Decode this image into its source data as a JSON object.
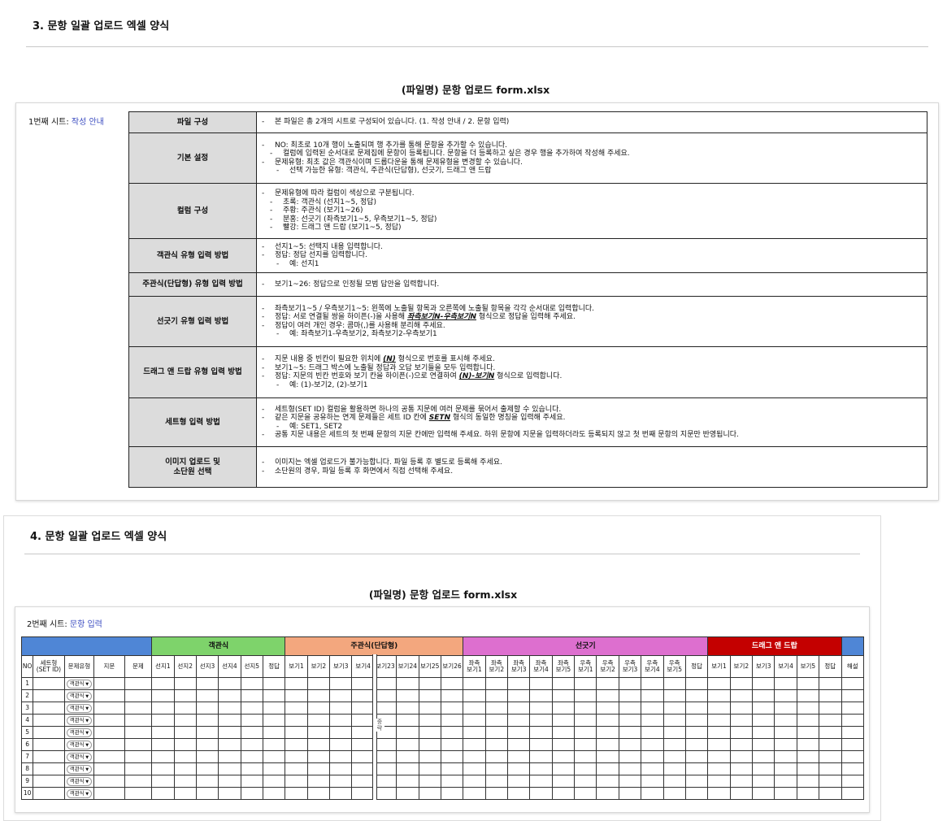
{
  "section3": {
    "title": "3. 문항 일괄 업로드 엑셀 양식",
    "file_title": "(파일명) 문항 업로드 form.xlsx",
    "sheet_label_prefix": "1번째 시트: ",
    "sheet_label_name": "작성 안내",
    "rows": [
      {
        "label": "파일 구성",
        "lines": [
          {
            "lv": 1,
            "t": "본 파일은 총 2개의 시트로 구성되어 있습니다. (1. 작성 안내 / 2. 문항 입력)"
          }
        ]
      },
      {
        "label": "기본 설정",
        "lines": [
          {
            "lv": 1,
            "t": "NO: 최초로 10개 행이 노출되며 행 추가를 통해 문항을 추가할 수 있습니다."
          },
          {
            "lv": 2,
            "t": "컬럼에 입력된 순서대로 문제집에 문항이 등록됩니다. 문항을 더 등록하고 싶은 경우 행을 추가하여 작성해 주세요."
          },
          {
            "lv": 1,
            "t": "문제유형: 최초 값은 객관식이며 드롭다운을 통해 문제유형을 변경할 수 있습니다."
          },
          {
            "lv": 3,
            "t": "선택 가능한 유형: 객관식, 주관식(단답형), 선긋기, 드래그 앤 드랍"
          }
        ]
      },
      {
        "label": "컬럼 구성",
        "lines": [
          {
            "lv": 1,
            "t": "문제유형에 따라 컬럼이 색상으로 구분됩니다."
          },
          {
            "lv": 2,
            "t": "초록: 객관식 (선지1~5, 정답)"
          },
          {
            "lv": 2,
            "t": "주황: 주관식 (보기1~26)"
          },
          {
            "lv": 2,
            "t": "분홍: 선긋기 (좌측보기1~5, 우측보기1~5, 정답)"
          },
          {
            "lv": 2,
            "t": "빨강: 드래그 앤 드랍 (보기1~5, 정답)"
          }
        ]
      },
      {
        "label": "객관식 유형 입력 방법",
        "lines": [
          {
            "lv": 1,
            "t": "선지1~5: 선택지 내용 입력합니다."
          },
          {
            "lv": 1,
            "t": "정답: 정답 선지를 입력합니다."
          },
          {
            "lv": 3,
            "t": "예: 선지1"
          }
        ]
      },
      {
        "label": "주관식(단답형) 유형 입력 방법",
        "lines": [
          {
            "lv": 1,
            "t": "보기1~26: 정답으로 인정될 모범 답안을 입력합니다."
          }
        ]
      },
      {
        "label": "선긋기 유형 입력 방법",
        "lines": [
          {
            "lv": 1,
            "t": "좌측보기1~5 / 우측보기1~5: 왼쪽에 노출될 항목과 오른쪽에 노출될 항목을 각각 순서대로 입력합니다."
          },
          {
            "lv": 1,
            "pre": "정답: 서로 연결될 쌍을 하이픈(-)을 사용해 ",
            "em": "좌측보기N-우측보기N",
            "post": " 형식으로 정답을 입력해 주세요."
          },
          {
            "lv": 1,
            "t": "정답이 여러 개인 경우: 콤마(,)를 사용해 분리해 주세요."
          },
          {
            "lv": 3,
            "t": "예: 좌측보기1-우측보기2, 좌측보기2-우측보기1"
          }
        ]
      },
      {
        "label": "드래그 앤 드랍 유형 입력 방법",
        "lines": [
          {
            "lv": 1,
            "pre": "지문 내용 중 빈칸이 필요한 위치에 ",
            "em": "(N)",
            "post": " 형식으로 번호를 표시해 주세요."
          },
          {
            "lv": 1,
            "t": "보기1~5: 드래그 박스에 노출될 정답과 오답 보기들을 모두 입력합니다."
          },
          {
            "lv": 1,
            "pre": "정답: 지문의 빈칸 번호와 보기 칸을 하이픈(-)으로 연결하여 ",
            "em": "(N)-보기N",
            "post": " 형식으로 입력합니다."
          },
          {
            "lv": 3,
            "t": "예: (1)-보기2, (2)-보기1"
          }
        ]
      },
      {
        "label": "세트형 입력 방법",
        "lines": [
          {
            "lv": 1,
            "t": "세트형(SET ID) 컬럼을 활용하면 하나의 공통 지문에 여러 문제를 묶어서 출제할 수 있습니다."
          },
          {
            "lv": 1,
            "pre": "같은 지문을 공유하는 연계 문제들은 세트 ID 칸에 ",
            "em": "SETN",
            "post": " 형식의 동일한 명칭을 입력해 주세요."
          },
          {
            "lv": 3,
            "t": "예: SET1, SET2"
          },
          {
            "lv": 1,
            "t": "공통 지문 내용은 세트의 첫 번째 문항의 지문 칸에만 입력해 주세요. 하위 문항에 지문을 입력하더라도 등록되지 않고 첫 번째 문항의 지문만 반영됩니다."
          }
        ]
      },
      {
        "label": "이미지 업로드 및\n소단원 선택",
        "lines": [
          {
            "lv": 1,
            "t": "이미지는 엑셀 업로드가 불가능합니다. 파일 등록 후 별도로 등록해 주세요."
          },
          {
            "lv": 1,
            "t": "소단원의 경우, 파일 등록 후 화면에서 직접 선택해 주세요."
          }
        ]
      }
    ]
  },
  "section4": {
    "title": "4. 문항 일괄 업로드 엑셀 양식",
    "file_title": "(파일명) 문항 업로드 form.xlsx",
    "sheet_label_prefix": "2번째 시트: ",
    "sheet_label_name": "문항 입력",
    "groups": {
      "objective": "객관식",
      "subjective": "주관식(단답형)",
      "matching": "선긋기",
      "dragdrop": "드래그 앤 드랍"
    },
    "columns": [
      "NO",
      "세트형\n(SET ID)",
      "문제유형",
      "지문",
      "문제",
      "선지1",
      "선지2",
      "선지3",
      "선지4",
      "선지5",
      "정답",
      "보기1",
      "보기2",
      "보기3",
      "보기4",
      "보기23",
      "보기24",
      "보기25",
      "보기26",
      "좌측\n보기1",
      "좌측\n보기2",
      "좌측\n보기3",
      "좌측\n보기4",
      "좌측\n보기5",
      "우측\n보기1",
      "우측\n보기2",
      "우측\n보기3",
      "우측\n보기4",
      "우측\n보기5",
      "정답",
      "보기1",
      "보기2",
      "보기3",
      "보기4",
      "보기5",
      "정답",
      "해설"
    ],
    "row_numbers": [
      "1",
      "2",
      "3",
      "4",
      "5",
      "6",
      "7",
      "8",
      "9",
      "10"
    ],
    "type_default": "객관식",
    "omitted_label": "중\n략",
    "colors": {
      "blue": "#4f86d6",
      "green": "#7ed36b",
      "orange": "#f3a77e",
      "pink": "#dd6fcf",
      "red": "#c40000"
    }
  }
}
